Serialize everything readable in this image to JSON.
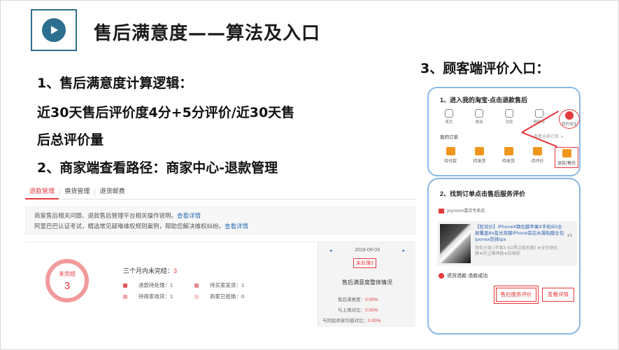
{
  "slide": {
    "title": "售后满意度——算法及入口",
    "line1": "1、售后满意度计算逻辑：",
    "line2": "近30天售后评价度4分+5分评价/近30天售",
    "line3": "后总评价量",
    "line4": "2、商家端查看路径：商家中心-退款管理",
    "section3": "3、顾客端评价入口："
  },
  "merchant": {
    "tabs": [
      {
        "label": "退款管理",
        "active": true
      },
      {
        "label": "换货管理",
        "active": false
      },
      {
        "label": "退货邮费",
        "active": false
      }
    ],
    "notice": {
      "line1": "商家售后相关问题、退款售后管理平台相关操作说明。",
      "link1": "查看详情",
      "line2": "阿里巴巴认证考试，精选常见疑难维权规则案例，帮助您解决维权纠纷。",
      "link2": "查看详情"
    },
    "ring": {
      "label": "未完结",
      "value": "3"
    },
    "summary": {
      "label": "三个月内未完结：",
      "value": "3"
    },
    "stats": [
      {
        "label": "退款待处理：1",
        "color": "#e05a5c"
      },
      {
        "label": "待买家发货：1",
        "color": "#e58a8b"
      },
      {
        "label": "待商家收货：1",
        "color": "#f0a6a7"
      },
      {
        "label": "商家已拒绝：0",
        "color": "#f6cacb"
      }
    ],
    "right": {
      "prev": "◂",
      "date": "2018-09-03",
      "next": "▸",
      "badge": "未处理3",
      "title": "售后满意度整体情况",
      "rows": [
        {
          "label": "售后满意度：",
          "value": "0.00%"
        },
        {
          "label": "与上周对比：",
          "value": "0.00%"
        },
        {
          "label": "与同层商家均值对比：",
          "value": "0.00%"
        }
      ]
    }
  },
  "customer": {
    "step1": "1、进入我的淘宝-点击退款售后",
    "nav": [
      "首页",
      "微淘",
      "消息",
      "购物车",
      "我的淘宝"
    ],
    "my_orders": "我的订单",
    "all_orders": "查看全部订单 >",
    "order_items": [
      "待付款",
      "待发货",
      "待收货",
      "待评价",
      "退款/售后"
    ],
    "step2": "2、找到订单点击售后服务评价",
    "store": "joyroom嘉百专卖店",
    "product_title": "【狂欢价】iPhoneX钢化膜苹果X手机6D全屏覆盖8x蓝光背膜iPhone前后水凝贴膜全包iponex防摔ipx",
    "product_spec": "颜色分类:[苹果X 6D黑边稳形膜] ★全包钢化膜★防尘嘴神器★防爆款",
    "qty": "x1",
    "status": "退货退款 退款成功",
    "btn_review": "售后服务评价",
    "btn_detail": "查看详情"
  }
}
